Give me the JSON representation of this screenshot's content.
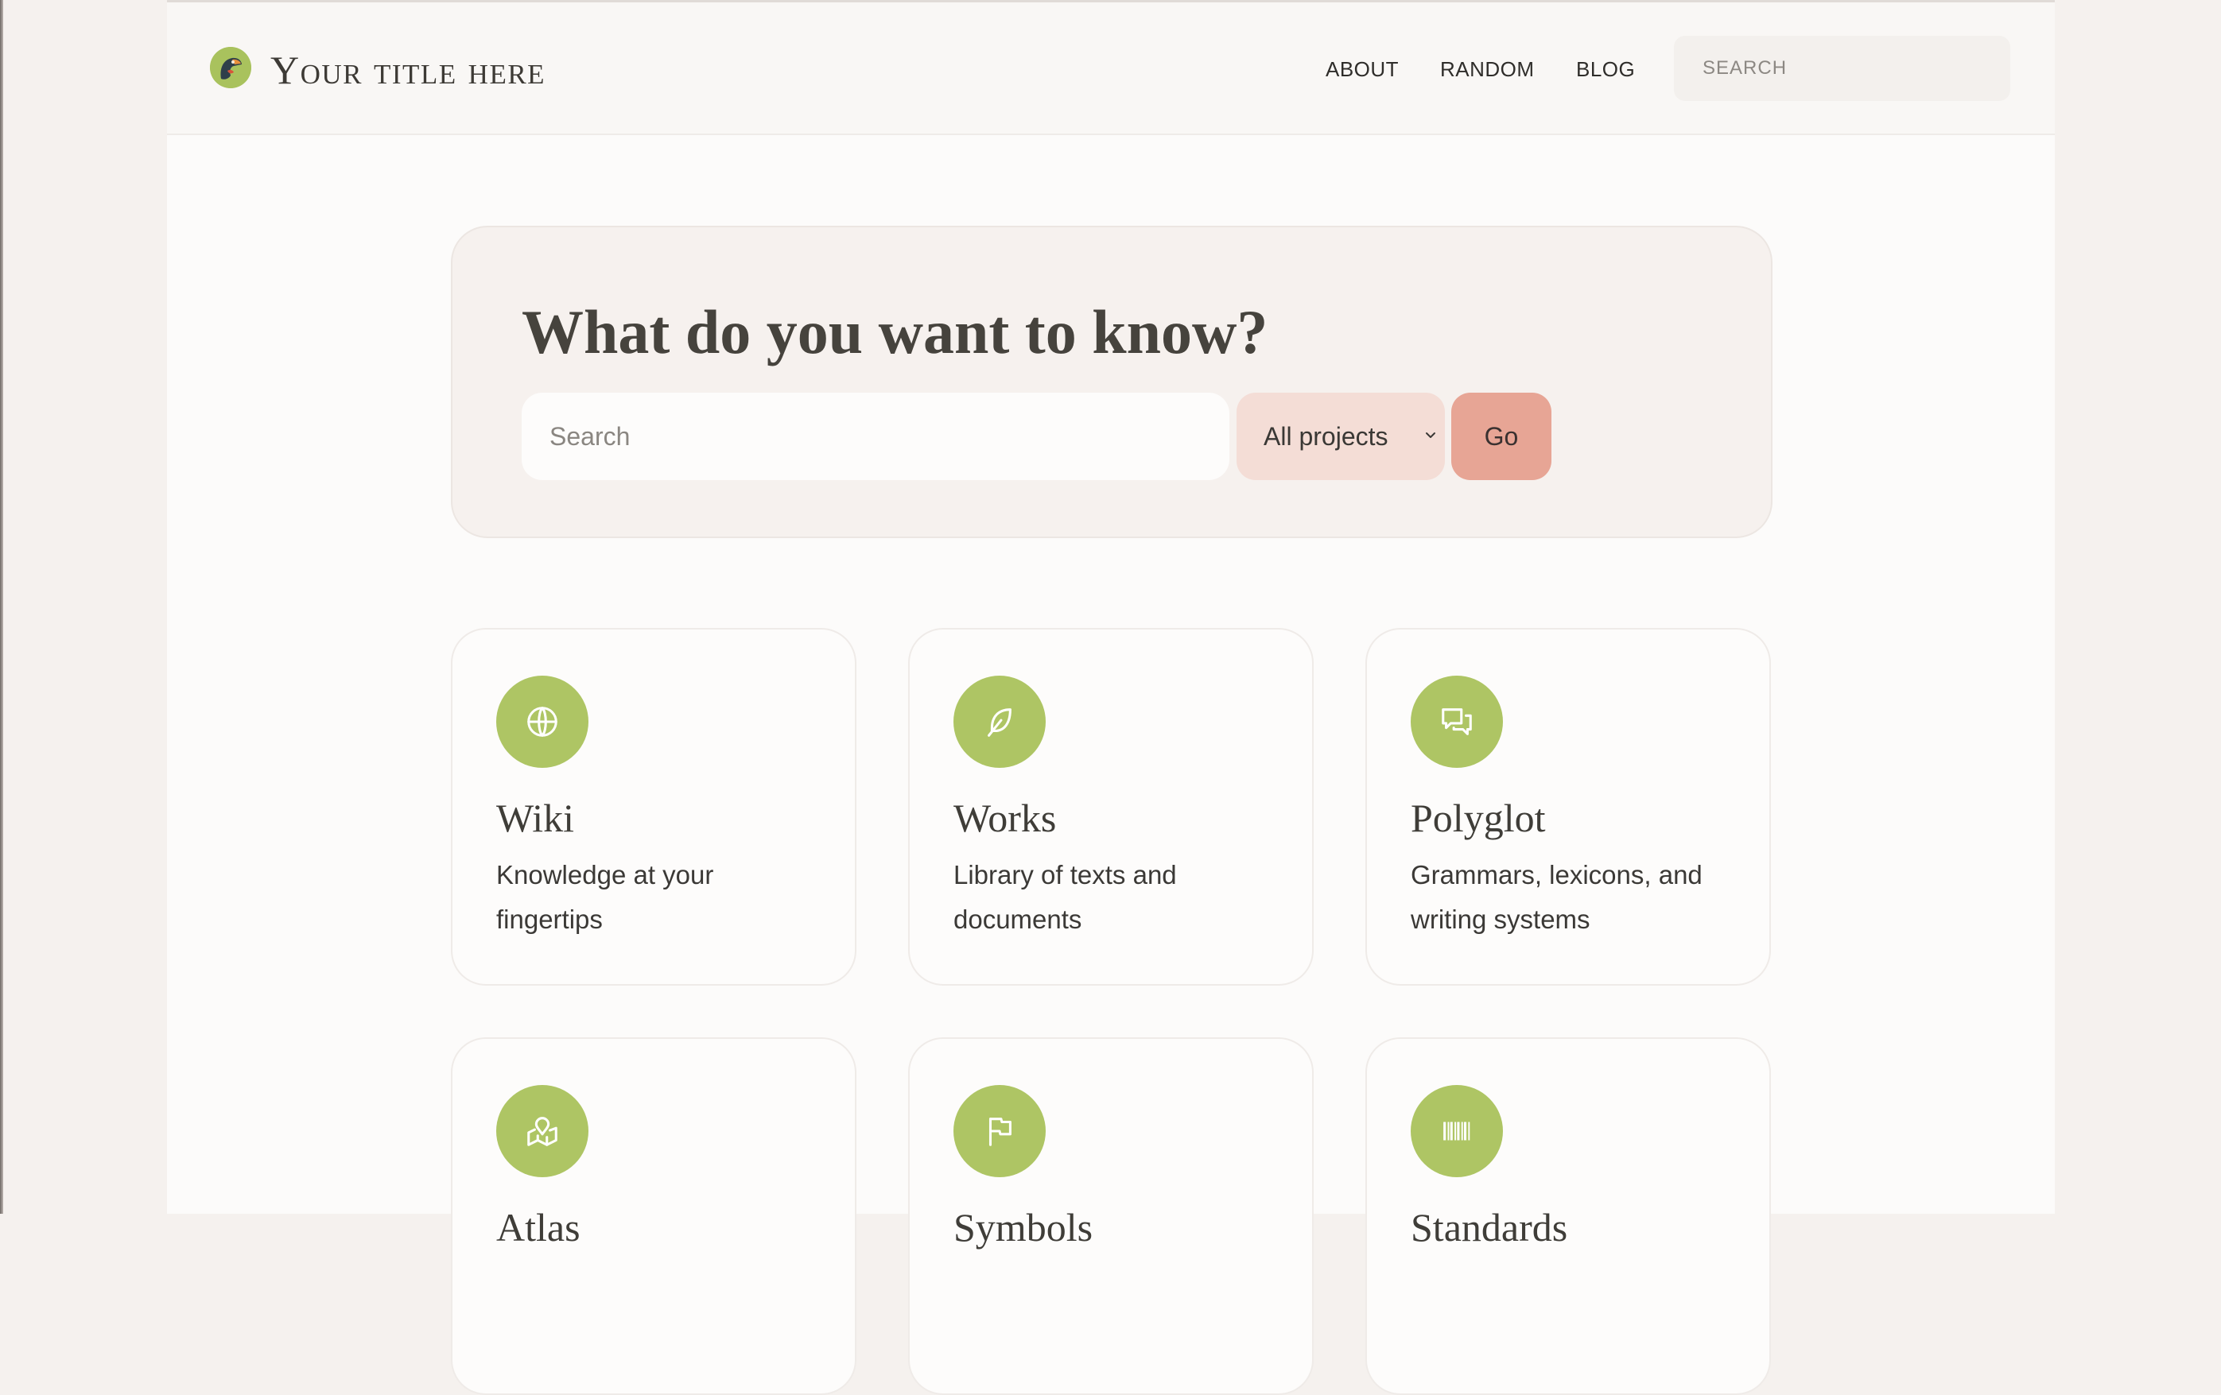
{
  "header": {
    "site_title": "Your title here",
    "nav": {
      "about": "ABOUT",
      "random": "RANDOM",
      "blog": "BLOG"
    },
    "search_placeholder": "SEARCH"
  },
  "hero": {
    "title": "What do you want to know?",
    "search_placeholder": "Search",
    "project_select": "All projects",
    "go_label": "Go"
  },
  "cards": [
    {
      "title": "Wiki",
      "description": "Knowledge at your fingertips",
      "icon": "globe-icon"
    },
    {
      "title": "Works",
      "description": "Library of texts and documents",
      "icon": "feather-icon"
    },
    {
      "title": "Polyglot",
      "description": "Grammars, lexicons, and writing systems",
      "icon": "chat-bubbles-icon"
    },
    {
      "title": "Atlas",
      "description": "",
      "icon": "map-pin-icon"
    },
    {
      "title": "Symbols",
      "description": "",
      "icon": "flag-icon"
    },
    {
      "title": "Standards",
      "description": "",
      "icon": "barcode-icon"
    }
  ],
  "colors": {
    "accent_green": "#aec564",
    "select_bg": "#f4ddd6",
    "go_button": "#e7a595",
    "hero_bg": "#f6f1ee",
    "page_bg": "#fcfbfa"
  }
}
